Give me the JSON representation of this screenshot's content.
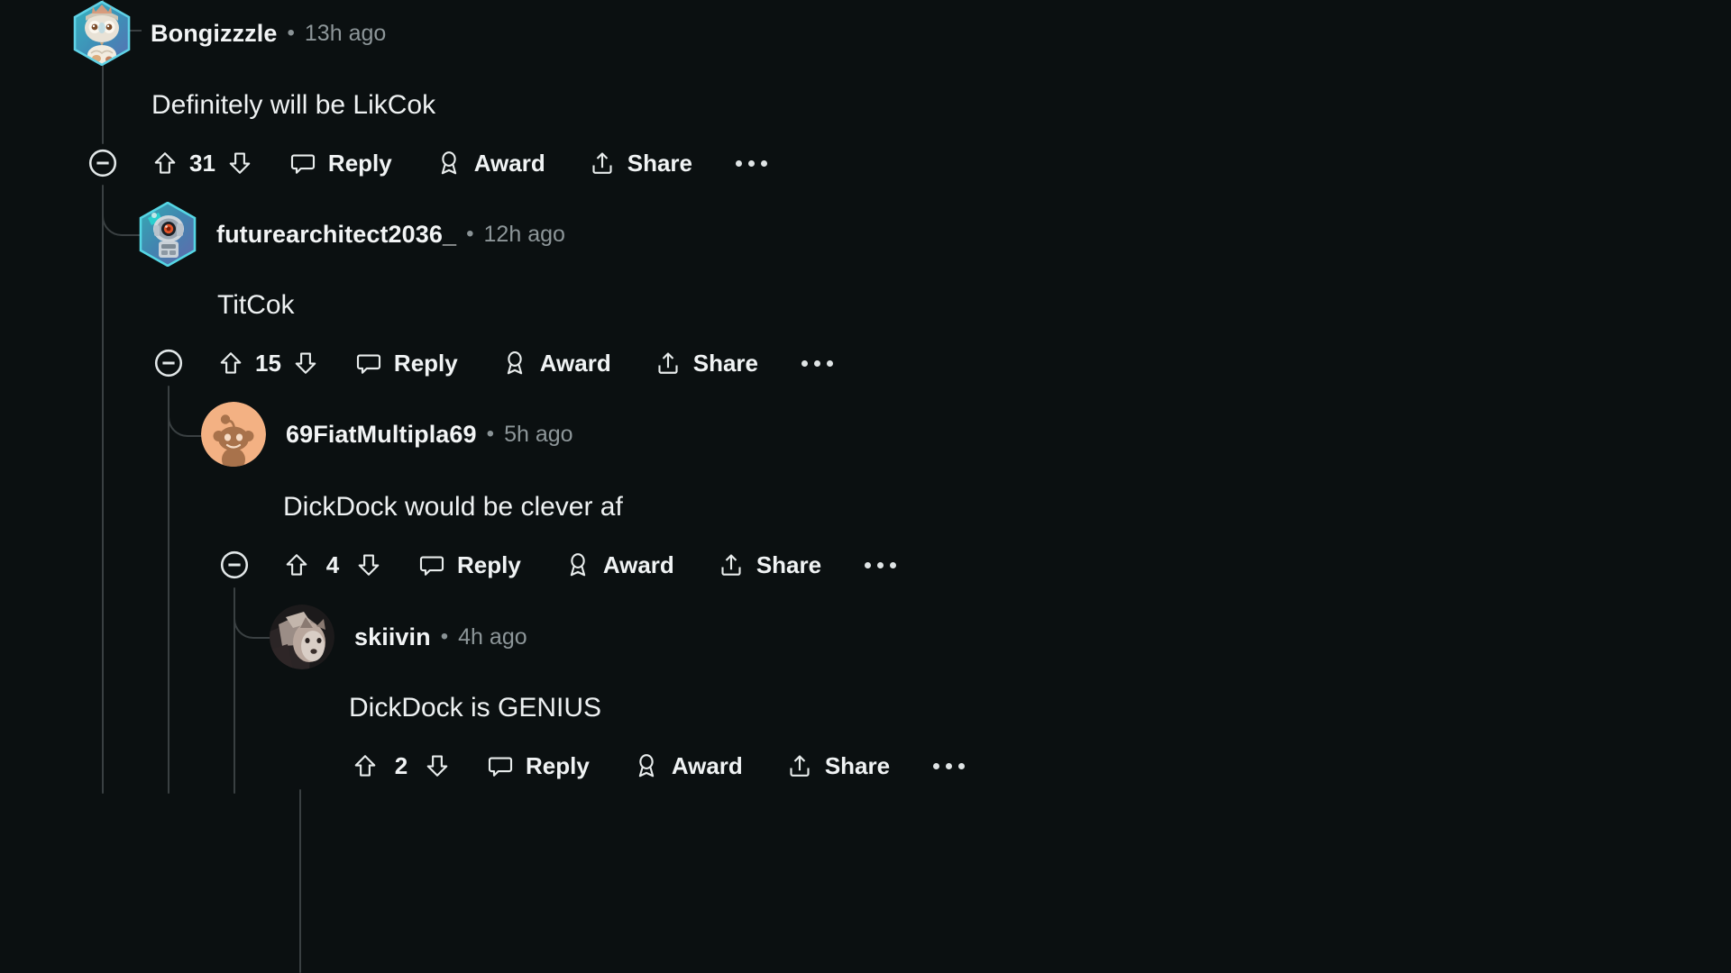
{
  "theme": {
    "background": "#0b1011",
    "text": "#eef1f2",
    "muted": "#8d9699",
    "rail": "#3a4042"
  },
  "labels": {
    "reply": "Reply",
    "award": "Award",
    "share": "Share",
    "collapse_icon": "collapse-icon",
    "upvote_icon": "upvote-icon",
    "downvote_icon": "downvote-icon",
    "more_icon": "more-options-icon"
  },
  "comments": [
    {
      "id": "c1",
      "username": "Bongizzzle",
      "separator": "•",
      "timestamp": "13h ago",
      "body": "Definitely will be LikCok",
      "votes": "31",
      "reply": "Reply",
      "award": "Award",
      "share": "Share",
      "avatar_type": "hex-robot-crown",
      "depth": 0,
      "has_collapse": true
    },
    {
      "id": "c2",
      "username": "futurearchitect2036_",
      "separator": "•",
      "timestamp": "12h ago",
      "body": "TitCok",
      "votes": "15",
      "reply": "Reply",
      "award": "Award",
      "share": "Share",
      "avatar_type": "hex-robot-teal",
      "depth": 1,
      "has_collapse": true
    },
    {
      "id": "c3",
      "username": "69FiatMultipla69",
      "separator": "•",
      "timestamp": "5h ago",
      "body": "DickDock would be clever af",
      "votes": "4",
      "reply": "Reply",
      "award": "Award",
      "share": "Share",
      "avatar_type": "snoo-orange",
      "depth": 2,
      "has_collapse": true
    },
    {
      "id": "c4",
      "username": "skiivin",
      "separator": "•",
      "timestamp": "4h ago",
      "body": "DickDock is GENIUS",
      "votes": "2",
      "reply": "Reply",
      "award": "Award",
      "share": "Share",
      "avatar_type": "photo-husky",
      "depth": 3,
      "has_collapse": false
    }
  ]
}
